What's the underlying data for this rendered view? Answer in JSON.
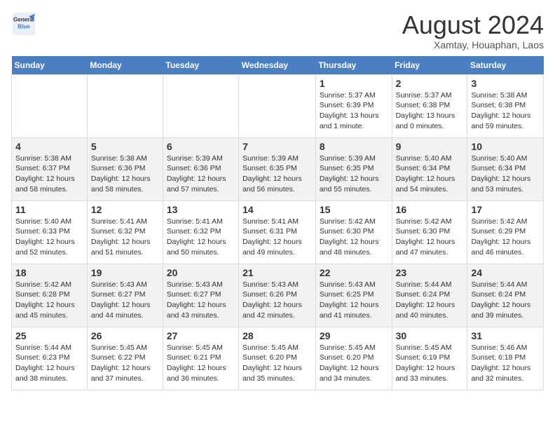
{
  "header": {
    "logo_line1": "General",
    "logo_line2": "Blue",
    "month_year": "August 2024",
    "location": "Xamtay, Houaphan, Laos"
  },
  "weekdays": [
    "Sunday",
    "Monday",
    "Tuesday",
    "Wednesday",
    "Thursday",
    "Friday",
    "Saturday"
  ],
  "weeks": [
    [
      {
        "day": "",
        "info": ""
      },
      {
        "day": "",
        "info": ""
      },
      {
        "day": "",
        "info": ""
      },
      {
        "day": "",
        "info": ""
      },
      {
        "day": "1",
        "info": "Sunrise: 5:37 AM\nSunset: 6:39 PM\nDaylight: 13 hours\nand 1 minute."
      },
      {
        "day": "2",
        "info": "Sunrise: 5:37 AM\nSunset: 6:38 PM\nDaylight: 13 hours\nand 0 minutes."
      },
      {
        "day": "3",
        "info": "Sunrise: 5:38 AM\nSunset: 6:38 PM\nDaylight: 12 hours\nand 59 minutes."
      }
    ],
    [
      {
        "day": "4",
        "info": "Sunrise: 5:38 AM\nSunset: 6:37 PM\nDaylight: 12 hours\nand 58 minutes."
      },
      {
        "day": "5",
        "info": "Sunrise: 5:38 AM\nSunset: 6:36 PM\nDaylight: 12 hours\nand 58 minutes."
      },
      {
        "day": "6",
        "info": "Sunrise: 5:39 AM\nSunset: 6:36 PM\nDaylight: 12 hours\nand 57 minutes."
      },
      {
        "day": "7",
        "info": "Sunrise: 5:39 AM\nSunset: 6:35 PM\nDaylight: 12 hours\nand 56 minutes."
      },
      {
        "day": "8",
        "info": "Sunrise: 5:39 AM\nSunset: 6:35 PM\nDaylight: 12 hours\nand 55 minutes."
      },
      {
        "day": "9",
        "info": "Sunrise: 5:40 AM\nSunset: 6:34 PM\nDaylight: 12 hours\nand 54 minutes."
      },
      {
        "day": "10",
        "info": "Sunrise: 5:40 AM\nSunset: 6:34 PM\nDaylight: 12 hours\nand 53 minutes."
      }
    ],
    [
      {
        "day": "11",
        "info": "Sunrise: 5:40 AM\nSunset: 6:33 PM\nDaylight: 12 hours\nand 52 minutes."
      },
      {
        "day": "12",
        "info": "Sunrise: 5:41 AM\nSunset: 6:32 PM\nDaylight: 12 hours\nand 51 minutes."
      },
      {
        "day": "13",
        "info": "Sunrise: 5:41 AM\nSunset: 6:32 PM\nDaylight: 12 hours\nand 50 minutes."
      },
      {
        "day": "14",
        "info": "Sunrise: 5:41 AM\nSunset: 6:31 PM\nDaylight: 12 hours\nand 49 minutes."
      },
      {
        "day": "15",
        "info": "Sunrise: 5:42 AM\nSunset: 6:30 PM\nDaylight: 12 hours\nand 48 minutes."
      },
      {
        "day": "16",
        "info": "Sunrise: 5:42 AM\nSunset: 6:30 PM\nDaylight: 12 hours\nand 47 minutes."
      },
      {
        "day": "17",
        "info": "Sunrise: 5:42 AM\nSunset: 6:29 PM\nDaylight: 12 hours\nand 46 minutes."
      }
    ],
    [
      {
        "day": "18",
        "info": "Sunrise: 5:42 AM\nSunset: 6:28 PM\nDaylight: 12 hours\nand 45 minutes."
      },
      {
        "day": "19",
        "info": "Sunrise: 5:43 AM\nSunset: 6:27 PM\nDaylight: 12 hours\nand 44 minutes."
      },
      {
        "day": "20",
        "info": "Sunrise: 5:43 AM\nSunset: 6:27 PM\nDaylight: 12 hours\nand 43 minutes."
      },
      {
        "day": "21",
        "info": "Sunrise: 5:43 AM\nSunset: 6:26 PM\nDaylight: 12 hours\nand 42 minutes."
      },
      {
        "day": "22",
        "info": "Sunrise: 5:43 AM\nSunset: 6:25 PM\nDaylight: 12 hours\nand 41 minutes."
      },
      {
        "day": "23",
        "info": "Sunrise: 5:44 AM\nSunset: 6:24 PM\nDaylight: 12 hours\nand 40 minutes."
      },
      {
        "day": "24",
        "info": "Sunrise: 5:44 AM\nSunset: 6:24 PM\nDaylight: 12 hours\nand 39 minutes."
      }
    ],
    [
      {
        "day": "25",
        "info": "Sunrise: 5:44 AM\nSunset: 6:23 PM\nDaylight: 12 hours\nand 38 minutes."
      },
      {
        "day": "26",
        "info": "Sunrise: 5:45 AM\nSunset: 6:22 PM\nDaylight: 12 hours\nand 37 minutes."
      },
      {
        "day": "27",
        "info": "Sunrise: 5:45 AM\nSunset: 6:21 PM\nDaylight: 12 hours\nand 36 minutes."
      },
      {
        "day": "28",
        "info": "Sunrise: 5:45 AM\nSunset: 6:20 PM\nDaylight: 12 hours\nand 35 minutes."
      },
      {
        "day": "29",
        "info": "Sunrise: 5:45 AM\nSunset: 6:20 PM\nDaylight: 12 hours\nand 34 minutes."
      },
      {
        "day": "30",
        "info": "Sunrise: 5:45 AM\nSunset: 6:19 PM\nDaylight: 12 hours\nand 33 minutes."
      },
      {
        "day": "31",
        "info": "Sunrise: 5:46 AM\nSunset: 6:18 PM\nDaylight: 12 hours\nand 32 minutes."
      }
    ]
  ]
}
